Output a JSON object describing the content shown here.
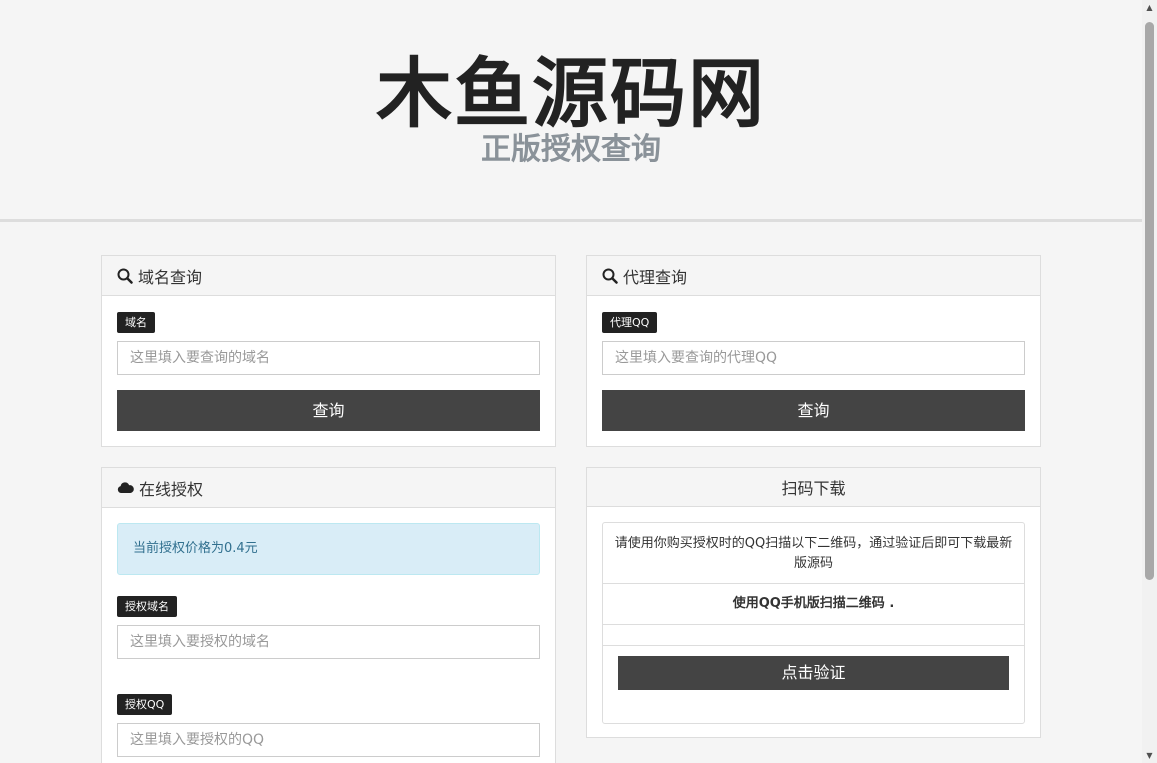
{
  "header": {
    "title": "木鱼源码网",
    "subtitle": "正版授权查询"
  },
  "domain_query": {
    "heading": "域名查询",
    "label": "域名",
    "placeholder": "这里填入要查询的域名",
    "button": "查询"
  },
  "agent_query": {
    "heading": "代理查询",
    "label": "代理QQ",
    "placeholder": "这里填入要查询的代理QQ",
    "button": "查询"
  },
  "online_auth": {
    "heading": "在线授权",
    "alert": "当前授权价格为0.4元",
    "domain_label": "授权域名",
    "domain_placeholder": "这里填入要授权的域名",
    "qq_label": "授权QQ",
    "qq_placeholder": "这里填入要授权的QQ"
  },
  "scan_download": {
    "heading": "扫码下载",
    "description": "请使用你购买授权时的QQ扫描以下二维码，通过验证后即可下载最新版源码",
    "scan_hint": "使用QQ手机版扫描二维码  .",
    "button": "点击验证"
  },
  "icons": {
    "search": "search-icon",
    "cloud": "cloud-icon"
  },
  "colors": {
    "button_bg": "#444444",
    "label_bg": "#222222",
    "alert_bg": "#d9edf7",
    "alert_text": "#31708f"
  }
}
